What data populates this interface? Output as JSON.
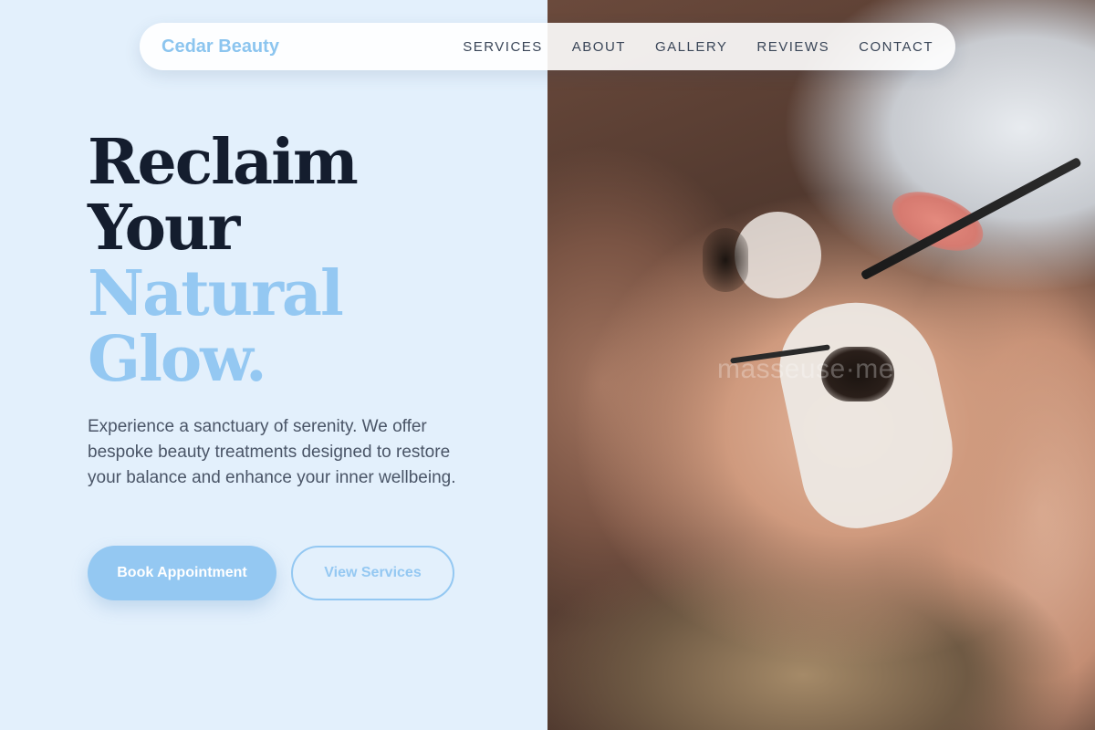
{
  "brand": {
    "name": "Cedar Beauty"
  },
  "nav": {
    "items": [
      {
        "label": "SERVICES"
      },
      {
        "label": "ABOUT"
      },
      {
        "label": "GALLERY"
      },
      {
        "label": "REVIEWS"
      },
      {
        "label": "CONTACT"
      }
    ]
  },
  "hero": {
    "title_line1": "Reclaim",
    "title_line2": "Your",
    "title_line3": "Natural",
    "title_line4": "Glow.",
    "description": "Experience a sanctuary of serenity. We offer bespoke beauty treatments designed to restore your balance and enhance your inner wellbeing.",
    "primary_button": "Book Appointment",
    "secondary_button": "View Services"
  },
  "photo": {
    "watermark": "masseuse·me"
  },
  "colors": {
    "accent": "#94c8f2",
    "brand": "#8cc5ef",
    "background": "#e3f0fc",
    "heading": "#141d2e",
    "body_text": "#4a5567"
  }
}
